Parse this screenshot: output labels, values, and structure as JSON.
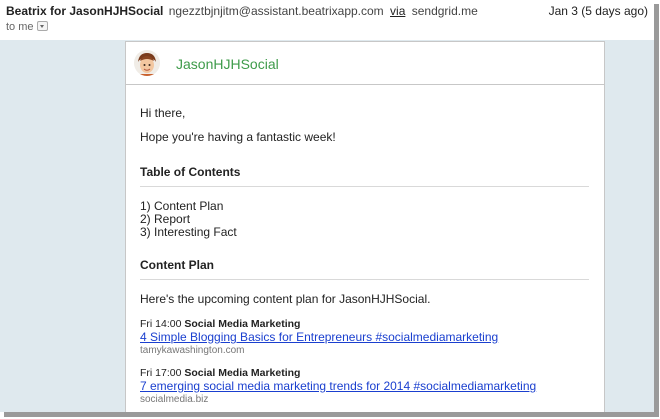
{
  "header": {
    "sender_name": "Beatrix for JasonHJHSocial",
    "sender_email": "ngezztbjnjitm@assistant.beatrixapp.com",
    "via_label": "via",
    "via_domain": "sendgrid.me",
    "date": "Jan 3 (5 days ago)",
    "to": "to me"
  },
  "email": {
    "brand": "JasonHJHSocial",
    "greeting": "Hi there,",
    "intro": "Hope you're having a fantastic week!",
    "toc_title": "Table of Contents",
    "toc_items": [
      "1) Content Plan",
      "2) Report",
      "3) Interesting Fact"
    ],
    "content_plan_title": "Content Plan",
    "content_plan_intro": "Here's the upcoming content plan for JasonHJHSocial.",
    "posts": [
      {
        "time": "Fri 14:00",
        "category": "Social Media Marketing",
        "title": "4 Simple Blogging Basics for Entrepreneurs #socialmediamarketing",
        "domain": "tamykawashington.com"
      },
      {
        "time": "Fri 17:00",
        "category": "Social Media Marketing",
        "title": "7 emerging social media marketing trends for 2014 #socialmediamarketing",
        "domain": "socialmedia.biz"
      }
    ]
  },
  "colors": {
    "brand": "#3e9b4a",
    "link": "#1a3fcf",
    "background": "#dfe9ee"
  }
}
